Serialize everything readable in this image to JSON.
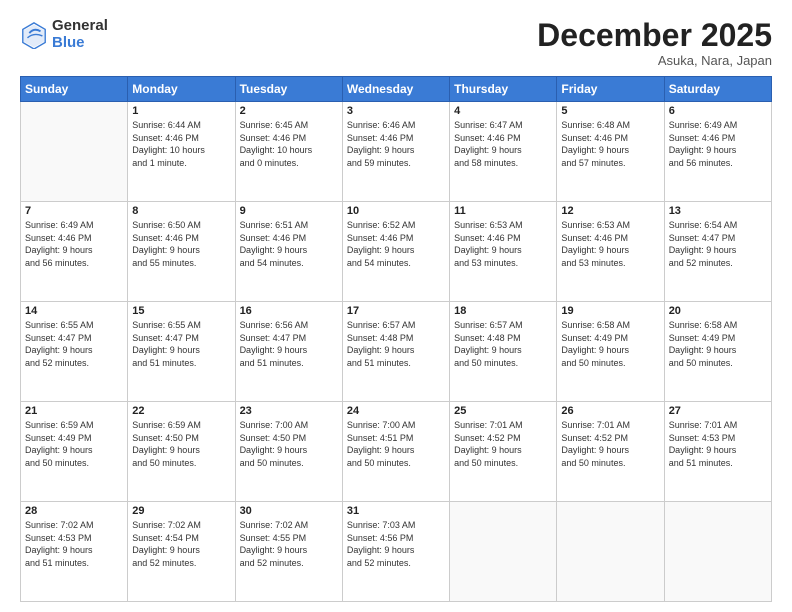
{
  "logo": {
    "general": "General",
    "blue": "Blue"
  },
  "header": {
    "month": "December 2025",
    "location": "Asuka, Nara, Japan"
  },
  "weekdays": [
    "Sunday",
    "Monday",
    "Tuesday",
    "Wednesday",
    "Thursday",
    "Friday",
    "Saturday"
  ],
  "weeks": [
    [
      {
        "day": "",
        "info": ""
      },
      {
        "day": "1",
        "info": "Sunrise: 6:44 AM\nSunset: 4:46 PM\nDaylight: 10 hours\nand 1 minute."
      },
      {
        "day": "2",
        "info": "Sunrise: 6:45 AM\nSunset: 4:46 PM\nDaylight: 10 hours\nand 0 minutes."
      },
      {
        "day": "3",
        "info": "Sunrise: 6:46 AM\nSunset: 4:46 PM\nDaylight: 9 hours\nand 59 minutes."
      },
      {
        "day": "4",
        "info": "Sunrise: 6:47 AM\nSunset: 4:46 PM\nDaylight: 9 hours\nand 58 minutes."
      },
      {
        "day": "5",
        "info": "Sunrise: 6:48 AM\nSunset: 4:46 PM\nDaylight: 9 hours\nand 57 minutes."
      },
      {
        "day": "6",
        "info": "Sunrise: 6:49 AM\nSunset: 4:46 PM\nDaylight: 9 hours\nand 56 minutes."
      }
    ],
    [
      {
        "day": "7",
        "info": "Sunrise: 6:49 AM\nSunset: 4:46 PM\nDaylight: 9 hours\nand 56 minutes."
      },
      {
        "day": "8",
        "info": "Sunrise: 6:50 AM\nSunset: 4:46 PM\nDaylight: 9 hours\nand 55 minutes."
      },
      {
        "day": "9",
        "info": "Sunrise: 6:51 AM\nSunset: 4:46 PM\nDaylight: 9 hours\nand 54 minutes."
      },
      {
        "day": "10",
        "info": "Sunrise: 6:52 AM\nSunset: 4:46 PM\nDaylight: 9 hours\nand 54 minutes."
      },
      {
        "day": "11",
        "info": "Sunrise: 6:53 AM\nSunset: 4:46 PM\nDaylight: 9 hours\nand 53 minutes."
      },
      {
        "day": "12",
        "info": "Sunrise: 6:53 AM\nSunset: 4:46 PM\nDaylight: 9 hours\nand 53 minutes."
      },
      {
        "day": "13",
        "info": "Sunrise: 6:54 AM\nSunset: 4:47 PM\nDaylight: 9 hours\nand 52 minutes."
      }
    ],
    [
      {
        "day": "14",
        "info": "Sunrise: 6:55 AM\nSunset: 4:47 PM\nDaylight: 9 hours\nand 52 minutes."
      },
      {
        "day": "15",
        "info": "Sunrise: 6:55 AM\nSunset: 4:47 PM\nDaylight: 9 hours\nand 51 minutes."
      },
      {
        "day": "16",
        "info": "Sunrise: 6:56 AM\nSunset: 4:47 PM\nDaylight: 9 hours\nand 51 minutes."
      },
      {
        "day": "17",
        "info": "Sunrise: 6:57 AM\nSunset: 4:48 PM\nDaylight: 9 hours\nand 51 minutes."
      },
      {
        "day": "18",
        "info": "Sunrise: 6:57 AM\nSunset: 4:48 PM\nDaylight: 9 hours\nand 50 minutes."
      },
      {
        "day": "19",
        "info": "Sunrise: 6:58 AM\nSunset: 4:49 PM\nDaylight: 9 hours\nand 50 minutes."
      },
      {
        "day": "20",
        "info": "Sunrise: 6:58 AM\nSunset: 4:49 PM\nDaylight: 9 hours\nand 50 minutes."
      }
    ],
    [
      {
        "day": "21",
        "info": "Sunrise: 6:59 AM\nSunset: 4:49 PM\nDaylight: 9 hours\nand 50 minutes."
      },
      {
        "day": "22",
        "info": "Sunrise: 6:59 AM\nSunset: 4:50 PM\nDaylight: 9 hours\nand 50 minutes."
      },
      {
        "day": "23",
        "info": "Sunrise: 7:00 AM\nSunset: 4:50 PM\nDaylight: 9 hours\nand 50 minutes."
      },
      {
        "day": "24",
        "info": "Sunrise: 7:00 AM\nSunset: 4:51 PM\nDaylight: 9 hours\nand 50 minutes."
      },
      {
        "day": "25",
        "info": "Sunrise: 7:01 AM\nSunset: 4:52 PM\nDaylight: 9 hours\nand 50 minutes."
      },
      {
        "day": "26",
        "info": "Sunrise: 7:01 AM\nSunset: 4:52 PM\nDaylight: 9 hours\nand 50 minutes."
      },
      {
        "day": "27",
        "info": "Sunrise: 7:01 AM\nSunset: 4:53 PM\nDaylight: 9 hours\nand 51 minutes."
      }
    ],
    [
      {
        "day": "28",
        "info": "Sunrise: 7:02 AM\nSunset: 4:53 PM\nDaylight: 9 hours\nand 51 minutes."
      },
      {
        "day": "29",
        "info": "Sunrise: 7:02 AM\nSunset: 4:54 PM\nDaylight: 9 hours\nand 52 minutes."
      },
      {
        "day": "30",
        "info": "Sunrise: 7:02 AM\nSunset: 4:55 PM\nDaylight: 9 hours\nand 52 minutes."
      },
      {
        "day": "31",
        "info": "Sunrise: 7:03 AM\nSunset: 4:56 PM\nDaylight: 9 hours\nand 52 minutes."
      },
      {
        "day": "",
        "info": ""
      },
      {
        "day": "",
        "info": ""
      },
      {
        "day": "",
        "info": ""
      }
    ]
  ]
}
